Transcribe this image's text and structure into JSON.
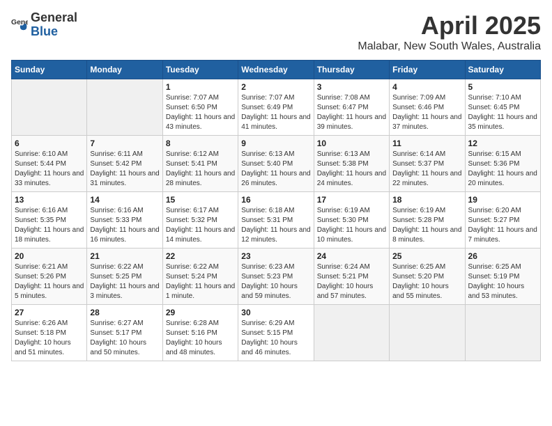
{
  "logo": {
    "general": "General",
    "blue": "Blue"
  },
  "title": "April 2025",
  "subtitle": "Malabar, New South Wales, Australia",
  "days_of_week": [
    "Sunday",
    "Monday",
    "Tuesday",
    "Wednesday",
    "Thursday",
    "Friday",
    "Saturday"
  ],
  "weeks": [
    [
      {
        "day": "",
        "info": ""
      },
      {
        "day": "",
        "info": ""
      },
      {
        "day": "1",
        "info": "Sunrise: 7:07 AM\nSunset: 6:50 PM\nDaylight: 11 hours and 43 minutes."
      },
      {
        "day": "2",
        "info": "Sunrise: 7:07 AM\nSunset: 6:49 PM\nDaylight: 11 hours and 41 minutes."
      },
      {
        "day": "3",
        "info": "Sunrise: 7:08 AM\nSunset: 6:47 PM\nDaylight: 11 hours and 39 minutes."
      },
      {
        "day": "4",
        "info": "Sunrise: 7:09 AM\nSunset: 6:46 PM\nDaylight: 11 hours and 37 minutes."
      },
      {
        "day": "5",
        "info": "Sunrise: 7:10 AM\nSunset: 6:45 PM\nDaylight: 11 hours and 35 minutes."
      }
    ],
    [
      {
        "day": "6",
        "info": "Sunrise: 6:10 AM\nSunset: 5:44 PM\nDaylight: 11 hours and 33 minutes."
      },
      {
        "day": "7",
        "info": "Sunrise: 6:11 AM\nSunset: 5:42 PM\nDaylight: 11 hours and 31 minutes."
      },
      {
        "day": "8",
        "info": "Sunrise: 6:12 AM\nSunset: 5:41 PM\nDaylight: 11 hours and 28 minutes."
      },
      {
        "day": "9",
        "info": "Sunrise: 6:13 AM\nSunset: 5:40 PM\nDaylight: 11 hours and 26 minutes."
      },
      {
        "day": "10",
        "info": "Sunrise: 6:13 AM\nSunset: 5:38 PM\nDaylight: 11 hours and 24 minutes."
      },
      {
        "day": "11",
        "info": "Sunrise: 6:14 AM\nSunset: 5:37 PM\nDaylight: 11 hours and 22 minutes."
      },
      {
        "day": "12",
        "info": "Sunrise: 6:15 AM\nSunset: 5:36 PM\nDaylight: 11 hours and 20 minutes."
      }
    ],
    [
      {
        "day": "13",
        "info": "Sunrise: 6:16 AM\nSunset: 5:35 PM\nDaylight: 11 hours and 18 minutes."
      },
      {
        "day": "14",
        "info": "Sunrise: 6:16 AM\nSunset: 5:33 PM\nDaylight: 11 hours and 16 minutes."
      },
      {
        "day": "15",
        "info": "Sunrise: 6:17 AM\nSunset: 5:32 PM\nDaylight: 11 hours and 14 minutes."
      },
      {
        "day": "16",
        "info": "Sunrise: 6:18 AM\nSunset: 5:31 PM\nDaylight: 11 hours and 12 minutes."
      },
      {
        "day": "17",
        "info": "Sunrise: 6:19 AM\nSunset: 5:30 PM\nDaylight: 11 hours and 10 minutes."
      },
      {
        "day": "18",
        "info": "Sunrise: 6:19 AM\nSunset: 5:28 PM\nDaylight: 11 hours and 8 minutes."
      },
      {
        "day": "19",
        "info": "Sunrise: 6:20 AM\nSunset: 5:27 PM\nDaylight: 11 hours and 7 minutes."
      }
    ],
    [
      {
        "day": "20",
        "info": "Sunrise: 6:21 AM\nSunset: 5:26 PM\nDaylight: 11 hours and 5 minutes."
      },
      {
        "day": "21",
        "info": "Sunrise: 6:22 AM\nSunset: 5:25 PM\nDaylight: 11 hours and 3 minutes."
      },
      {
        "day": "22",
        "info": "Sunrise: 6:22 AM\nSunset: 5:24 PM\nDaylight: 11 hours and 1 minute."
      },
      {
        "day": "23",
        "info": "Sunrise: 6:23 AM\nSunset: 5:23 PM\nDaylight: 10 hours and 59 minutes."
      },
      {
        "day": "24",
        "info": "Sunrise: 6:24 AM\nSunset: 5:21 PM\nDaylight: 10 hours and 57 minutes."
      },
      {
        "day": "25",
        "info": "Sunrise: 6:25 AM\nSunset: 5:20 PM\nDaylight: 10 hours and 55 minutes."
      },
      {
        "day": "26",
        "info": "Sunrise: 6:25 AM\nSunset: 5:19 PM\nDaylight: 10 hours and 53 minutes."
      }
    ],
    [
      {
        "day": "27",
        "info": "Sunrise: 6:26 AM\nSunset: 5:18 PM\nDaylight: 10 hours and 51 minutes."
      },
      {
        "day": "28",
        "info": "Sunrise: 6:27 AM\nSunset: 5:17 PM\nDaylight: 10 hours and 50 minutes."
      },
      {
        "day": "29",
        "info": "Sunrise: 6:28 AM\nSunset: 5:16 PM\nDaylight: 10 hours and 48 minutes."
      },
      {
        "day": "30",
        "info": "Sunrise: 6:29 AM\nSunset: 5:15 PM\nDaylight: 10 hours and 46 minutes."
      },
      {
        "day": "",
        "info": ""
      },
      {
        "day": "",
        "info": ""
      },
      {
        "day": "",
        "info": ""
      }
    ]
  ]
}
